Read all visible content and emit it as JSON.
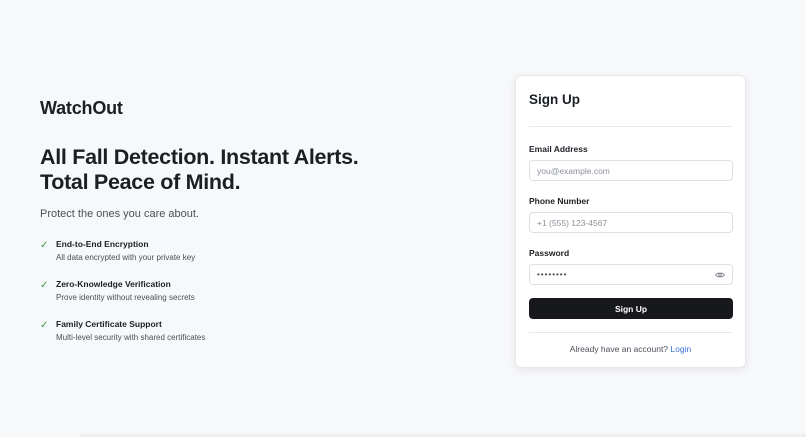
{
  "brand": "WatchOut",
  "hero": {
    "headline_line1": "All Fall Detection. Instant Alerts.",
    "headline_line2": "Total Peace of Mind.",
    "tagline": "Protect the ones you care about."
  },
  "features": [
    {
      "title": "End-to-End Encryption",
      "description": "All data encrypted with your private key",
      "icon": "check-icon"
    },
    {
      "title": "Zero-Knowledge Verification",
      "description": "Prove identity without revealing secrets",
      "icon": "check-icon"
    },
    {
      "title": "Family Certificate Support",
      "description": "Multi-level security with shared certificates",
      "icon": "check-icon"
    }
  ],
  "signup": {
    "title": "Sign Up",
    "email_label": "Email Address",
    "email_placeholder": "you@example.com",
    "phone_label": "Phone Number",
    "phone_placeholder": "+1 (555) 123-4567",
    "password_label": "Password",
    "password_mask": "••••••••",
    "submit_label": "Sign Up",
    "login_prompt": "Already have an account?",
    "login_link": "Login"
  },
  "colors": {
    "accent_check": "#2f9e44",
    "button_bg": "#16181b",
    "link": "#3b6fd8",
    "background": "#f7f8fa"
  }
}
